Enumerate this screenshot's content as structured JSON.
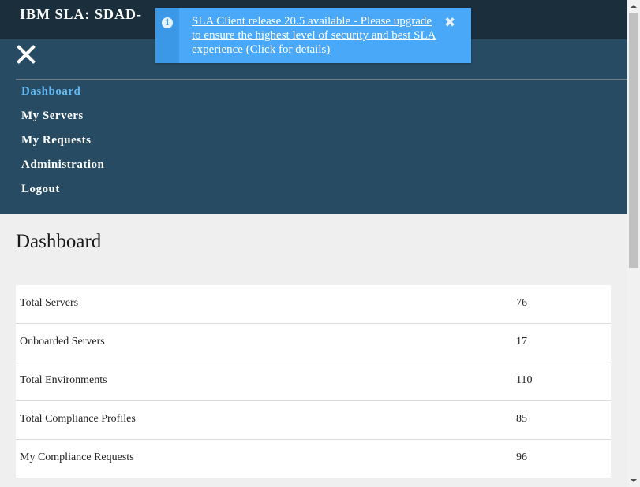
{
  "app": {
    "title": "IBM SLA: SDAD-"
  },
  "icons": {
    "menu_close": "close-icon",
    "notification": "info-icon",
    "notification_close": "close-icon"
  },
  "nav": {
    "items": [
      {
        "label": "Dashboard",
        "active": true
      },
      {
        "label": "My Servers"
      },
      {
        "label": "My Requests"
      },
      {
        "label": "Administration"
      },
      {
        "label": "Logout"
      }
    ]
  },
  "notification": {
    "message": "SLA Client release 20.5 available - Please upgrade to ensure the highest level of security and best SLA experience (Click for details)",
    "info_glyph": "i",
    "close_glyph": "✖"
  },
  "main": {
    "title": "Dashboard",
    "stats": [
      {
        "label": "Total Servers",
        "value": "76"
      },
      {
        "label": "Onboarded Servers",
        "value": "17"
      },
      {
        "label": "Total Environments",
        "value": "110"
      },
      {
        "label": "Total Compliance Profiles",
        "value": "85"
      },
      {
        "label": "My Compliance Requests",
        "value": "96"
      }
    ]
  },
  "colors": {
    "header_bg": "#1b2e3c",
    "menu_bg": "#274b62",
    "active_nav": "#61b8f2",
    "toast_bg": "#4aa8f8",
    "page_bg": "#efefef"
  }
}
